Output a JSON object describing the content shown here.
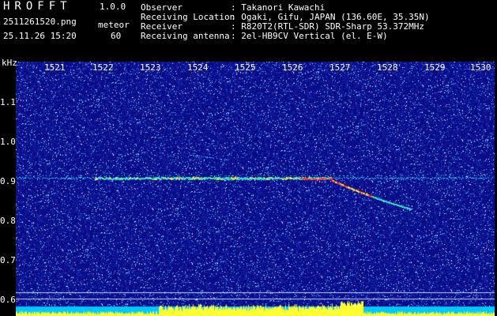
{
  "header": {
    "logo": "HROFFT",
    "version": "1.0.0",
    "filename": "2511261520.png",
    "datetime": "25.11.26 15:20",
    "meteor_label": "meteor",
    "meteor_count": "60",
    "observer_label": "Observer",
    "observer_value": ": Takanori Kawachi",
    "location_label": "Receiving Location",
    "location_value": ": Ogaki, Gifu, JAPAN (136.60E, 35.35N)",
    "receiver_label": "Receiver",
    "receiver_value": ": R820T2(RTL-SDR) SDR-Sharp 53.372MHz",
    "antenna_label": "Receiving antenna",
    "antenna_value": ": 2el-HB9CV Vertical (el. E-W)"
  },
  "axes": {
    "y_unit": "kHz",
    "y_ticks": [
      "1.1",
      "1.0",
      "0.9",
      "0.8",
      "0.7",
      "0.6"
    ],
    "x_ticks": [
      "1521",
      "1522",
      "1523",
      "1524",
      "1525",
      "1526",
      "1527",
      "1528",
      "1529",
      "1530"
    ]
  },
  "colors": {
    "background": "#0a0a86",
    "noise_hot": "#ffffff",
    "trace": "#2fd8ff",
    "meteor_hot": "#ff3030",
    "meteor_warm": "#ffe030",
    "bottom_bar": "#00c8ff",
    "bottom_peaks": "#ffff33",
    "grid_line": "#bcd4ff"
  }
}
